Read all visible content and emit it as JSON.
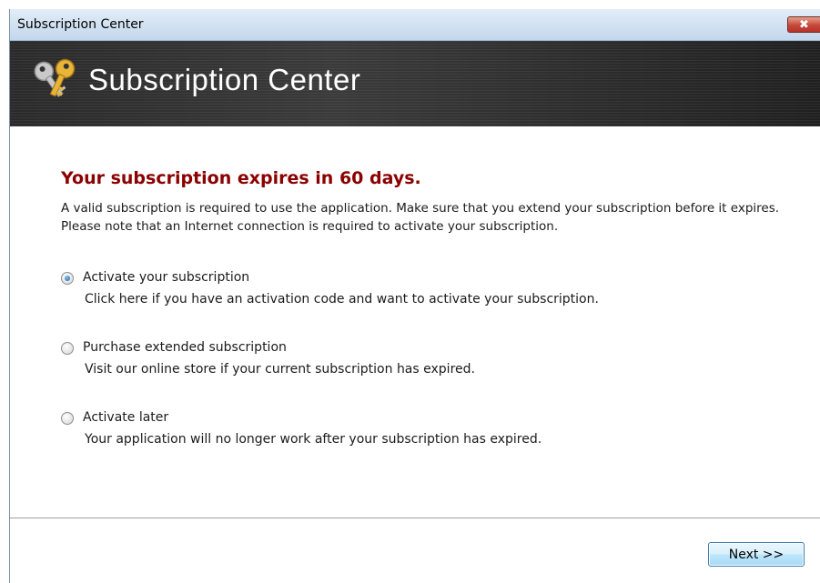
{
  "window": {
    "title": "Subscription Center",
    "close_label": "✖"
  },
  "banner": {
    "title": "Subscription Center",
    "icon": "keys-icon"
  },
  "main": {
    "heading": "Your subscription expires in 60 days.",
    "description": "A valid subscription is required to use the application. Make sure that you extend your subscription before it expires. Please note that an Internet connection is required to activate your subscription."
  },
  "options": [
    {
      "label": "Activate your subscription",
      "description": "Click here if you have an activation code and want to activate your subscription.",
      "selected": true
    },
    {
      "label": "Purchase extended subscription",
      "description": "Visit our online store if your current subscription has expired.",
      "selected": false
    },
    {
      "label": "Activate later",
      "description": "Your application will no longer work after your subscription has expired.",
      "selected": false
    }
  ],
  "footer": {
    "next_label": "Next >>"
  },
  "colors": {
    "heading": "#8b0000",
    "banner_bg": "#2a2a2a",
    "button_border": "#3c7fb1"
  }
}
